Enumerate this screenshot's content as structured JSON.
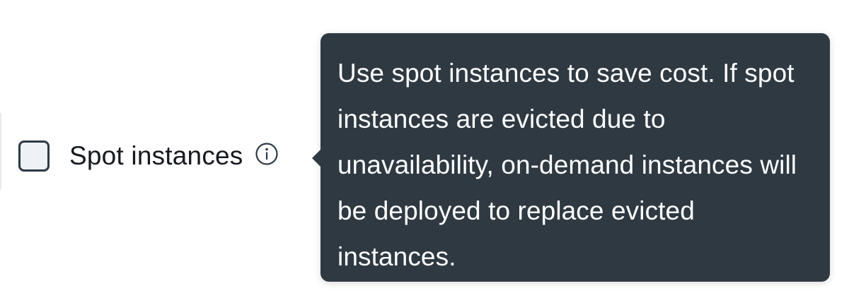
{
  "option": {
    "label": "Spot instances",
    "checked": false,
    "info_icon": "info-circle-icon"
  },
  "tooltip": {
    "text": "Use spot instances to save cost. If spot instances are evicted due to unavailability, on-demand instances will be deployed to replace evicted instances."
  },
  "colors": {
    "tooltip_background": "#2f3942",
    "tooltip_text": "#ffffff",
    "checkbox_border": "#2c3a47",
    "checkbox_fill": "#eef2f7",
    "label_text": "#16191f"
  }
}
